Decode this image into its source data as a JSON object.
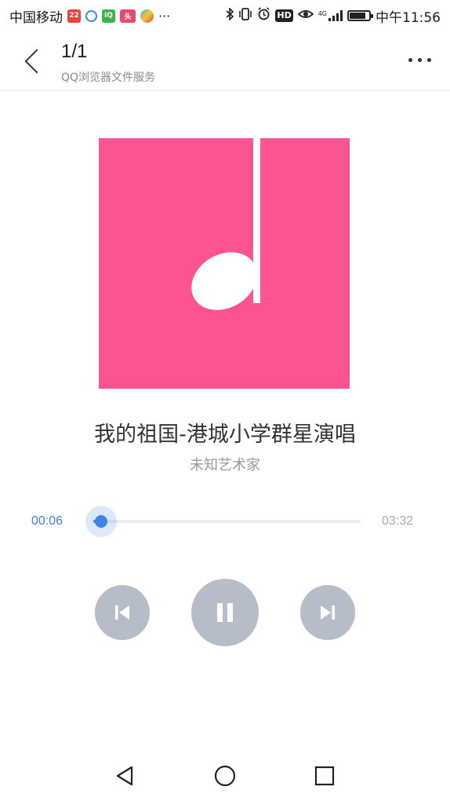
{
  "status_bar": {
    "carrier": "中国移动",
    "app_icons": [
      "notification-app-red-icon",
      "browser-app-icon",
      "iqiyi-app-icon",
      "toutiao-app-icon",
      "video-app-icon"
    ],
    "overflow": "···",
    "icons": [
      "bluetooth-icon",
      "vibrate-icon",
      "alarm-icon",
      "hd-icon",
      "eye-care-icon",
      "signal-4g-icon",
      "battery-icon"
    ],
    "network": "4G",
    "hd_label": "HD",
    "time": "中午11:56",
    "battery_level": 0.85
  },
  "header": {
    "title": "1/1",
    "subtitle": "QQ浏览器文件服务"
  },
  "player": {
    "track_title": "我的祖国-港城小学群星演唱",
    "artist": "未知艺术家",
    "current_time": "00:06",
    "total_time": "03:32",
    "progress": 0.028,
    "album_color": "#fc5391",
    "accent_color": "#3f82e8",
    "control_color": "#b7bcc9"
  },
  "controls": {
    "prev": "skip-previous-icon",
    "pause": "pause-icon",
    "next": "skip-next-icon"
  },
  "nav_bar": {
    "back": "triangle-back-icon",
    "home": "circle-home-icon",
    "recent": "square-recents-icon"
  }
}
